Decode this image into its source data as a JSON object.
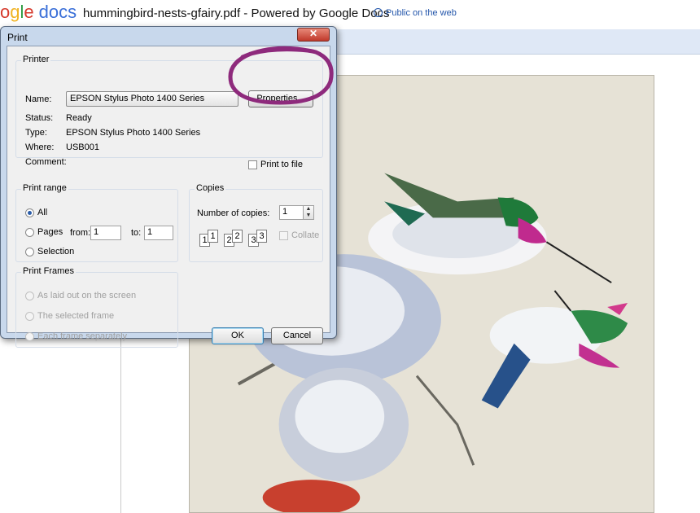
{
  "docs_header": {
    "logo_letters": [
      "o",
      "g",
      "l",
      "e"
    ],
    "logo_product": "docs",
    "document_title": "hummingbird-nests-gfairy.pdf - Powered by Google Docs",
    "sharing_status": "Public on the web"
  },
  "print_dialog": {
    "title": "Print",
    "printer": {
      "legend": "Printer",
      "name_label": "Name:",
      "name_value": "EPSON Stylus Photo 1400 Series",
      "properties_button": "Properties...",
      "status_label": "Status:",
      "status_value": "Ready",
      "type_label": "Type:",
      "type_value": "EPSON Stylus Photo 1400 Series",
      "where_label": "Where:",
      "where_value": "USB001",
      "comment_label": "Comment:",
      "print_to_file_label": "Print to file",
      "print_to_file_checked": false
    },
    "print_range": {
      "legend": "Print range",
      "all_label": "All",
      "pages_label": "Pages",
      "from_label": "from:",
      "from_value": "1",
      "to_label": "to:",
      "to_value": "1",
      "selection_label": "Selection",
      "selected_option": "All"
    },
    "copies": {
      "legend": "Copies",
      "number_label": "Number of copies:",
      "number_value": "1",
      "collate_label": "Collate",
      "collate_checked": false,
      "collate_sheets": [
        "1",
        "1",
        "2",
        "2",
        "3",
        "3"
      ]
    },
    "print_frames": {
      "legend": "Print Frames",
      "options": [
        "As laid out on the screen",
        "The selected frame",
        "Each frame separately"
      ]
    },
    "ok_button": "OK",
    "cancel_button": "Cancel"
  },
  "colors": {
    "annotation_circle": "#8e2a7c",
    "dialog_frame": "#c8d8ec",
    "docs_toolbar": "#dfe8f6"
  },
  "icons": [
    "globe-icon",
    "close-icon",
    "chevron-down-icon",
    "spin-up-icon",
    "spin-down-icon"
  ]
}
